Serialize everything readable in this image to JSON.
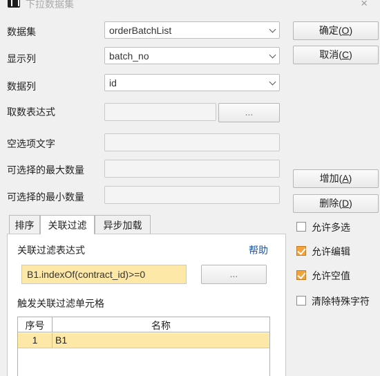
{
  "window": {
    "title": "下拉数据集",
    "close": "×"
  },
  "fields": {
    "dataset_label": "数据集",
    "dataset_value": "orderBatchList",
    "display_col_label": "显示列",
    "display_col_value": "batch_no",
    "data_col_label": "数据列",
    "data_col_value": "id",
    "fetch_expr_label": "取数表达式",
    "fetch_expr_btn": "...",
    "empty_option_label": "空选项文字",
    "max_select_label": "可选择的最大数量",
    "min_select_label": "可选择的最小数量"
  },
  "buttons": {
    "ok": "确定(",
    "ok_key": "O",
    "cancel": "取消(",
    "cancel_key": "C",
    "add": "增加(",
    "add_key": "A",
    "delete": "删除(",
    "delete_key": "D",
    "close_paren": ")"
  },
  "tabs": [
    "排序",
    "关联过滤",
    "异步加载"
  ],
  "filter": {
    "expr_label": "关联过滤表达式",
    "help": "帮助",
    "expr_value": "B1.indexOf(contract_id)>=0",
    "expr_btn": "...",
    "trigger_label": "触发关联过滤单元格",
    "grid_headers": [
      "序号",
      "名称"
    ],
    "grid_rows": [
      {
        "index": "1",
        "name": "B1"
      }
    ]
  },
  "options": [
    {
      "label": "允许多选",
      "checked": false
    },
    {
      "label": "允许编辑",
      "checked": true
    },
    {
      "label": "允许空值",
      "checked": true
    },
    {
      "label": "清除特殊字符",
      "checked": false
    }
  ]
}
